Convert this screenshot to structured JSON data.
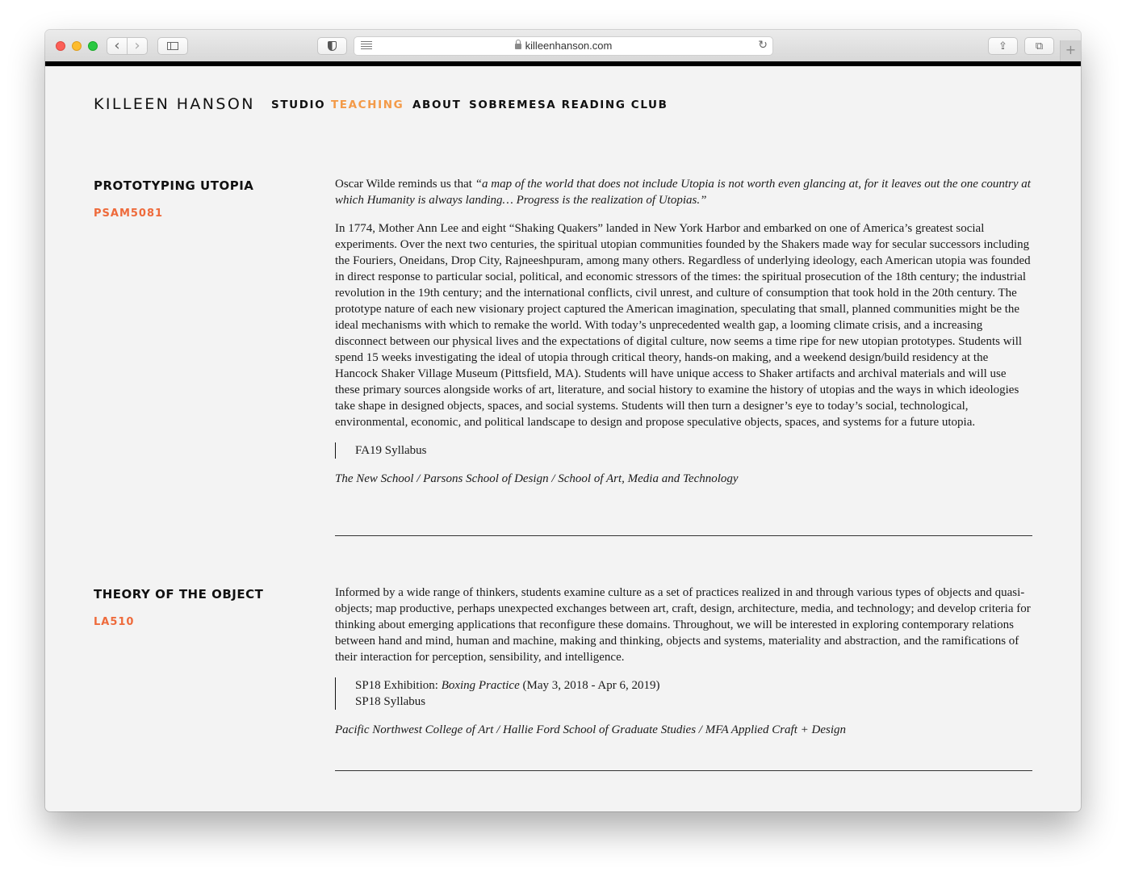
{
  "browser": {
    "url": "killeenhanson.com",
    "icons": [
      "close-icon",
      "minimize-icon",
      "zoom-icon",
      "back-icon",
      "forward-icon",
      "sidebar-icon",
      "privacy-icon",
      "reader-icon",
      "lock-icon",
      "reload-icon",
      "share-icon",
      "tabs-icon",
      "new-tab-icon"
    ],
    "back_glyph": "‹",
    "forward_glyph": "›",
    "share_glyph": "⇪",
    "tabs_glyph": "⧉",
    "new_tab_glyph": "+",
    "reload_glyph": "↻"
  },
  "site": {
    "logo": "KILLEEN HANSON",
    "nav": [
      {
        "label": "STUDIO",
        "active": false
      },
      {
        "label": "TEACHING",
        "active": true
      },
      {
        "label": "ABOUT",
        "active": false
      },
      {
        "label": "SOBREMESA READING CLUB",
        "active": false
      }
    ],
    "accent_color": "#f39a48",
    "code_color": "#ee6a3b"
  },
  "courses": [
    {
      "title": "PROTOTYPING UTOPIA",
      "code": "PSAM5081",
      "quote_intro": "Oscar Wilde reminds us that ",
      "quote": "“a map of the world that does not include Utopia is not worth even glancing at, for it leaves out the one country at which Humanity is always landing… Progress is the realization of Utopias.”",
      "description": "In 1774, Mother Ann Lee and eight “Shaking Quakers” landed in New York Harbor and embarked on one of America’s greatest social experiments. Over the next two centuries, the spiritual utopian communities founded by the Shakers made way for secular successors including the Fouriers, Oneidans, Drop City, Rajneeshpuram, among many others. Regardless of underlying ideology, each American utopia was founded in direct response to particular social, political, and economic stressors of the times: the spiritual prosecution of the 18th century; the industrial revolution in the 19th century; and the international conflicts, civil unrest, and culture of consumption that took hold in the 20th century. The prototype nature of each new visionary project captured the American imagination, speculating that small, planned communities might be the ideal mechanisms with which to remake the world. With today’s unprecedented wealth gap, a looming climate crisis, and a increasing disconnect between our physical lives and the expectations of digital culture, now seems a time ripe for new utopian prototypes. Students will spend 15 weeks investigating the ideal of utopia through critical theory, hands-on making, and a weekend design/build residency at the Hancock Shaker Village Museum (Pittsfield, MA). Students will have unique access to Shaker artifacts and archival materials and will use these primary sources alongside works of art, literature, and social history to examine the history of utopias and the ways in which ideologies take shape in designed objects, spaces, and social systems. Students will then turn a designer’s eye to today’s social, technological, environmental, economic, and political landscape to design and propose speculative objects, spaces, and systems for a future utopia.",
      "link_syllabus": "FA19 Syllabus",
      "institution": "The New School / Parsons School of Design / School of Art, Media and Technology"
    },
    {
      "title": "THEORY OF THE OBJECT",
      "code": "LA510",
      "description": "Informed by a wide range of thinkers, students examine culture as a set of practices realized in and through various types of objects and quasi-objects; map productive, perhaps unexpected exchanges between art, craft, design, architecture, media, and technology; and develop criteria for thinking about emerging applications that reconfigure these domains. Throughout, we will be interested in exploring contemporary relations between hand and mind, human and machine, making and thinking, objects and systems, materiality and abstraction, and the ramifications of their interaction for perception, sensibility, and intelligence.",
      "link_exhibition_prefix": "SP18 Exhibition: ",
      "link_exhibition_title": "Boxing Practice",
      "link_exhibition_dates": " (May 3, 2018 - Apr 6, 2019)",
      "link_syllabus": "SP18 Syllabus",
      "institution": "Pacific Northwest College of Art / Hallie Ford School of Graduate Studies / MFA Applied Craft + Design"
    }
  ]
}
